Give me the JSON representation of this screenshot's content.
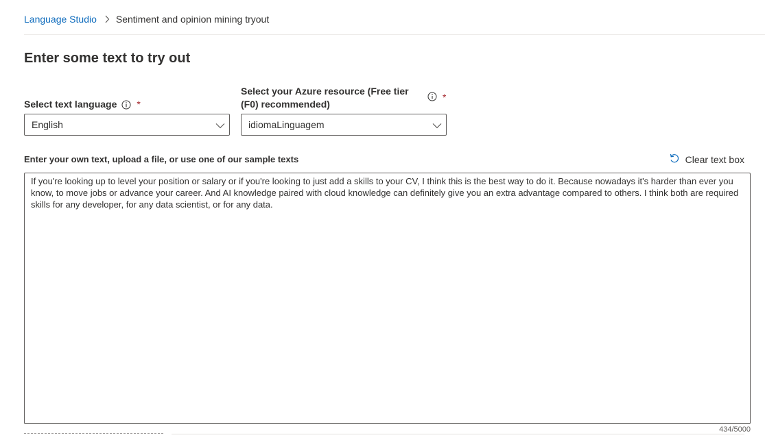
{
  "breadcrumb": {
    "root": "Language Studio",
    "current": "Sentiment and opinion mining tryout"
  },
  "page_title": "Enter some text to try out",
  "language_field": {
    "label": "Select text language",
    "required_mark": "*",
    "value": "English"
  },
  "resource_field": {
    "label": "Select your Azure resource (Free tier (F0) recommended)",
    "required_mark": "*",
    "value": "idiomaLinguagem"
  },
  "text_input": {
    "label": "Enter your own text, upload a file, or use one of our sample texts",
    "clear_label": "Clear text box",
    "value": "If you're looking up to level your position or salary or if you're looking to just add a skills to your CV, I think this is the best way to do it. Because nowadays it's harder than ever you know, to move jobs or advance your career. And AI knowledge paired with cloud knowledge can definitely give you an extra advantage compared to others. I think both are required skills for any developer, for any data scientist, or for any data.",
    "counter": "434/5000"
  },
  "icons": {
    "breadcrumb_separator": "chevron-right-icon",
    "info": "info-icon",
    "dropdown": "chevron-down-icon",
    "clear": "undo-icon"
  },
  "colors": {
    "link": "#0f6cbd",
    "required": "#a4262c",
    "border": "#605e5c"
  }
}
